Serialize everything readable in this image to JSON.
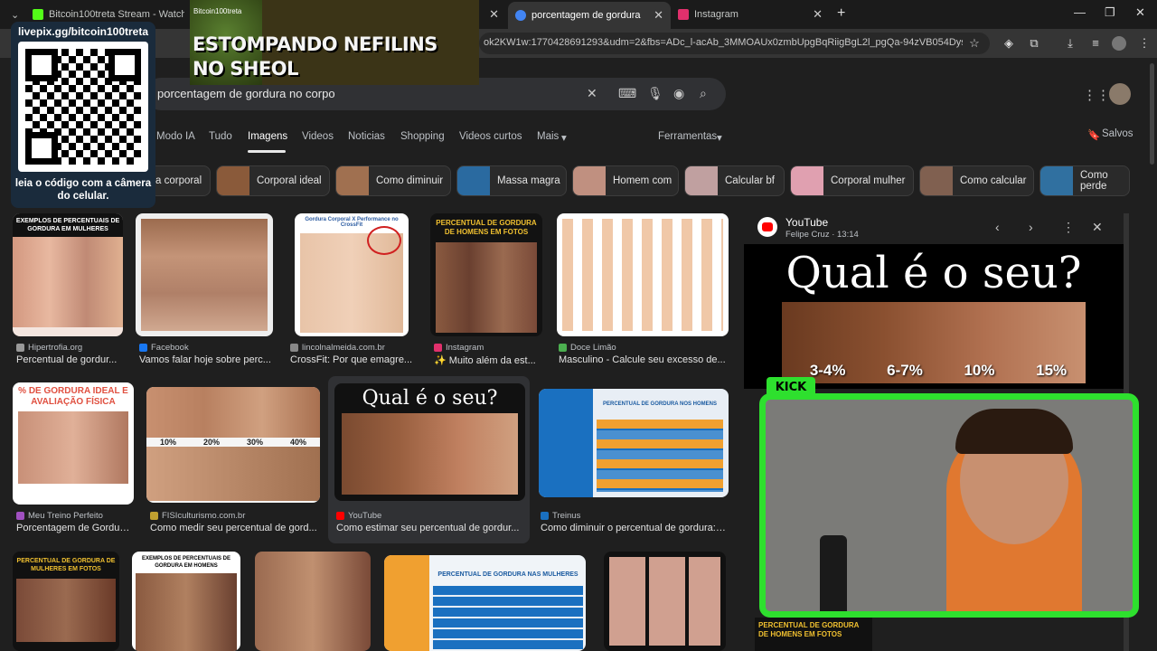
{
  "tabs": [
    {
      "label": "Bitcoin100treta Stream - Watch",
      "color": "#53fc18"
    },
    {
      "label": "porcentagem de gordura no corpo",
      "color": "#4285f4"
    },
    {
      "label": "Instagram",
      "color": "#e1306c"
    }
  ],
  "url": "ok2KW1w:1770428691293&udm=2&fbs=ADc_l-acAb_3MMOAUx0zmbUpgBqRiigBgL2l_pgQa-94zVB054Dys3s2x_...",
  "search": {
    "query": "porcentagem de gordura no corpo"
  },
  "nav": {
    "tabs": [
      "Modo IA",
      "Tudo",
      "Imagens",
      "Videos",
      "Noticias",
      "Shopping",
      "Videos curtos",
      "Mais"
    ],
    "tools": "Ferramentas",
    "saved": "Salvos"
  },
  "chips": [
    "a corporal",
    "Corporal ideal",
    "Como diminuir",
    "Massa magra",
    "Homem com",
    "Calcular bf",
    "Corporal mulher",
    "Como calcular",
    "Como perde"
  ],
  "results": [
    {
      "source": "Hipertrofia.org",
      "caption": "Percentual de gordur...",
      "title_in_image": "EXEMPLOS DE PERCENTUAIS DE GORDURA EM MULHERES"
    },
    {
      "source": "Facebook",
      "caption": "Vamos falar hoje sobre perc..."
    },
    {
      "source": "lincolnalmeida.com.br",
      "caption": "CrossFit: Por que emagre...",
      "title_in_image": "Gordura Corporal X Performance no CrossFit"
    },
    {
      "source": "Instagram",
      "caption": "✨ Muito além da est...",
      "title_in_image": "PERCENTUAL DE GORDURA DE HOMENS EM FOTOS"
    },
    {
      "source": "Doce Limão",
      "caption": "Masculino - Calcule seu excesso de..."
    },
    {
      "source": "Meu Treino Perfeito",
      "caption": "Porcentagem de Gordura...",
      "title_in_image": "% DE GORDURA IDEAL E AVALIAÇÃO FÍSICA"
    },
    {
      "source": "FISIculturismo.com.br",
      "caption": "Como medir seu percentual de gord...",
      "percents": [
        "10%",
        "20%",
        "30%",
        "40%"
      ]
    },
    {
      "source": "YouTube",
      "caption": "Como estimar seu percentual de gordur...",
      "title_in_image": "Qual é o seu?"
    },
    {
      "source": "Treinus",
      "caption": "Como diminuir o percentual de gordura: ...",
      "title_in_image": "PERCENTUAL DE GORDURA NOS HOMENS"
    }
  ],
  "panel": {
    "source": "YouTube",
    "author": "Felipe Cruz · 13:14",
    "image_title": "Qual é o seu?",
    "percents": [
      "3-4%",
      "6-7%",
      "10%",
      "15%"
    ]
  },
  "overlay": {
    "qr_url": "livepix.gg/bitcoin100treta",
    "qr_text": "leia o código com a câmera do celular.",
    "banner": "ESTOMPANDO NEFILINS\nNO SHEOL",
    "banner_small": "Bitcoin100treta",
    "kick": "KICK"
  },
  "bottom": {
    "women_title": "PERCENTUAL DE GORDURA DE MULHERES EM FOTOS",
    "men_examples": "EXEMPLOS DE PERCENTUAIS DE GORDURA EM HOMENS",
    "women_table": "PERCENTUAL DE GORDURA NAS MULHERES",
    "panel_bottom": "PERCENTUAL DE GORDURA DE HOMENS EM FOTOS"
  }
}
